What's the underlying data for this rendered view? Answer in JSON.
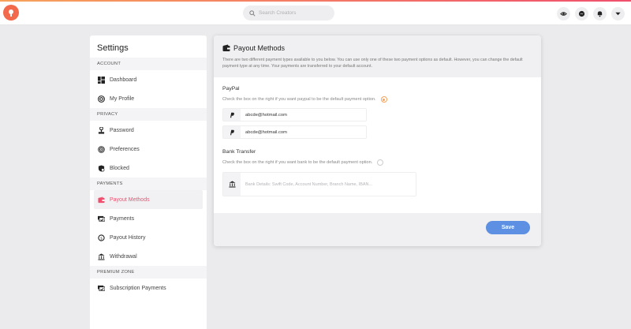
{
  "search": {
    "placeholder": "Search Creators"
  },
  "sidebar": {
    "title": "Settings",
    "sections": [
      {
        "heading": "ACCOUNT",
        "items": [
          {
            "label": "Dashboard",
            "icon": "dashboard-icon"
          },
          {
            "label": "My Profile",
            "icon": "profile-icon"
          }
        ]
      },
      {
        "heading": "PRIVACY",
        "items": [
          {
            "label": "Password",
            "icon": "password-icon"
          },
          {
            "label": "Preferences",
            "icon": "preferences-icon"
          },
          {
            "label": "Blocked",
            "icon": "blocked-icon"
          }
        ]
      },
      {
        "heading": "PAYMENTS",
        "items": [
          {
            "label": "Payout Methods",
            "icon": "wallet-icon"
          },
          {
            "label": "Payments",
            "icon": "payments-icon"
          },
          {
            "label": "Payout History",
            "icon": "history-icon"
          },
          {
            "label": "Withdrawal",
            "icon": "bank-icon"
          }
        ]
      },
      {
        "heading": "PREMIUM ZONE",
        "items": [
          {
            "label": "Subscription Payments",
            "icon": "subscription-icon"
          }
        ]
      }
    ]
  },
  "panel": {
    "title": "Payout Methods",
    "description": "There are two different payment types available to you below. You can use only one of these two payment options as default. However, you can change the default payment type at any time. Your payments are transferred to your default account.",
    "paypal": {
      "title": "PayPal",
      "hint": "Check the box on the right if you want paypal to be the default payment option.",
      "emails": [
        "abcde@hotmail.com",
        "abcde@hotmail.com"
      ]
    },
    "bank": {
      "title": "Bank Transfer",
      "hint": "Check the box on the right if you want bank to be the default payment option.",
      "placeholder": "Bank Details: Swift Code, Account Number, Branch Name, IBAN..."
    },
    "save_label": "Save"
  },
  "colors": {
    "accent": "#f0506e",
    "primary_button": "#5d8fe3",
    "radio_selected": "#f7a35c"
  }
}
